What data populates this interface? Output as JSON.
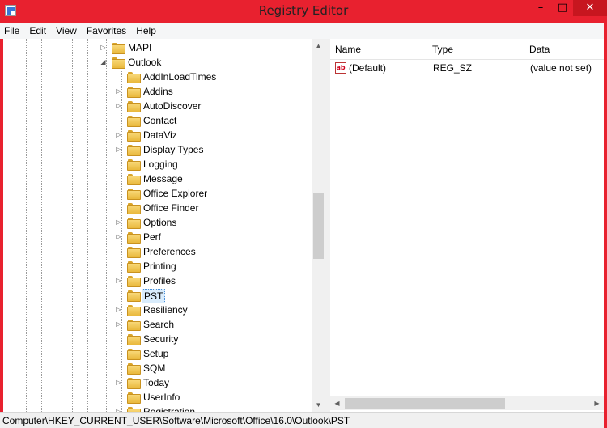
{
  "window": {
    "title": "Registry Editor",
    "minimize_glyph": "–",
    "maximize_glyph": "□",
    "close_glyph": "✕",
    "accent_color": "#e8212f"
  },
  "menu": [
    "File",
    "Edit",
    "View",
    "Favorites",
    "Help"
  ],
  "tree": {
    "nodes": [
      {
        "label": "MAPI",
        "expander": "▷"
      },
      {
        "label": "Outlook",
        "expander": "◢"
      },
      {
        "label": "AddInLoadTimes",
        "expander": ""
      },
      {
        "label": "Addins",
        "expander": "▷"
      },
      {
        "label": "AutoDiscover",
        "expander": "▷"
      },
      {
        "label": "Contact",
        "expander": ""
      },
      {
        "label": "DataViz",
        "expander": "▷"
      },
      {
        "label": "Display Types",
        "expander": "▷"
      },
      {
        "label": "Logging",
        "expander": ""
      },
      {
        "label": "Message",
        "expander": ""
      },
      {
        "label": "Office Explorer",
        "expander": ""
      },
      {
        "label": "Office Finder",
        "expander": ""
      },
      {
        "label": "Options",
        "expander": "▷"
      },
      {
        "label": "Perf",
        "expander": "▷"
      },
      {
        "label": "Preferences",
        "expander": ""
      },
      {
        "label": "Printing",
        "expander": ""
      },
      {
        "label": "Profiles",
        "expander": "▷"
      },
      {
        "label": "PST",
        "expander": "",
        "selected": true
      },
      {
        "label": "Resiliency",
        "expander": "▷"
      },
      {
        "label": "Search",
        "expander": "▷"
      },
      {
        "label": "Security",
        "expander": ""
      },
      {
        "label": "Setup",
        "expander": ""
      },
      {
        "label": "SQM",
        "expander": ""
      },
      {
        "label": "Today",
        "expander": "▷"
      },
      {
        "label": "UserInfo",
        "expander": ""
      },
      {
        "label": "Registration",
        "expander": "▷"
      }
    ],
    "scroll_up": "▲",
    "scroll_down": "▼",
    "scroll_position_fraction": 0.43
  },
  "list": {
    "columns": [
      "Name",
      "Type",
      "Data"
    ],
    "rows": [
      {
        "name": "(Default)",
        "type": "REG_SZ",
        "data": "(value not set)",
        "icon": "string-value-icon",
        "icon_text": "ab"
      }
    ],
    "scroll_left": "◀",
    "scroll_right": "▶"
  },
  "status": {
    "path": "Computer\\HKEY_CURRENT_USER\\Software\\Microsoft\\Office\\16.0\\Outlook\\PST"
  }
}
